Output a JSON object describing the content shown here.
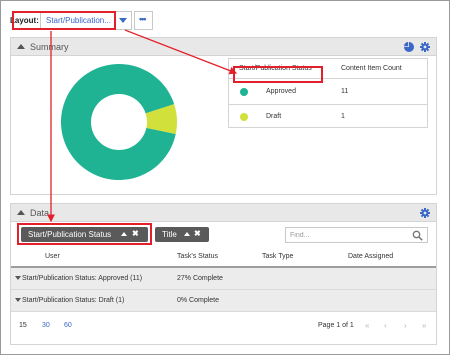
{
  "layout": {
    "label": "Layout:",
    "value": "Start/Publication..."
  },
  "summary": {
    "title": "Summary",
    "table": {
      "col_status": "Start/Publication Status",
      "col_count": "Content Item Count",
      "rows": [
        {
          "label": "Approved",
          "count": "11",
          "color": "#1fb393"
        },
        {
          "label": "Draft",
          "count": "1",
          "color": "#d1e03a"
        }
      ]
    }
  },
  "chart_data": {
    "type": "pie",
    "categories": [
      "Approved",
      "Draft"
    ],
    "values": [
      11,
      1
    ],
    "colors": [
      "#1fb393",
      "#d1e03a"
    ],
    "title": "",
    "legend": "right"
  },
  "data": {
    "title": "Data",
    "chips": [
      {
        "label": "Start/Publication Status"
      },
      {
        "label": "Title"
      }
    ],
    "search_placeholder": "Find...",
    "columns": [
      "User",
      "Task's Status",
      "Task Type",
      "Date Assigned"
    ],
    "groups": [
      {
        "label": "Start/Publication Status: Approved (11)",
        "status": "27% Complete"
      },
      {
        "label": "Start/Publication Status: Draft (1)",
        "status": "0% Complete"
      }
    ],
    "pager": {
      "sizes": [
        "15",
        "30",
        "60"
      ],
      "info": "Page 1 of 1"
    }
  },
  "colors": {
    "accent": "#3b67c6",
    "callout": "#e2202b",
    "chip_bg": "#5a5a5a"
  }
}
